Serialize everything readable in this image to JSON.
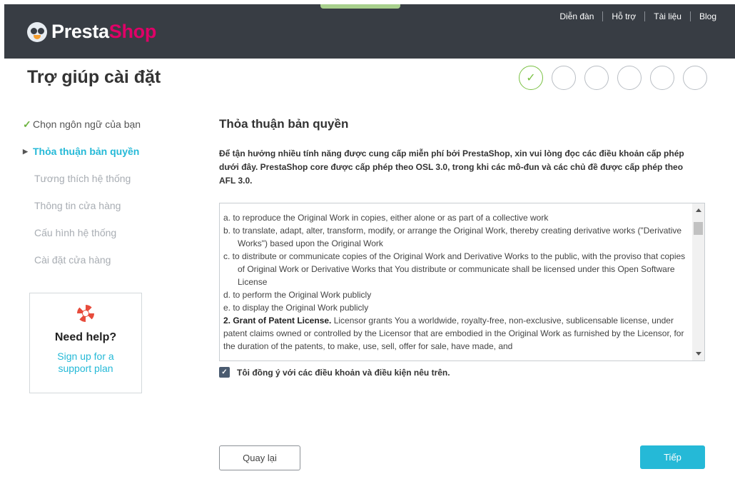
{
  "header": {
    "brand_part1": "Presta",
    "brand_part2": "Shop",
    "links": [
      "Diễn đàn",
      "Hỗ trợ",
      "Tài liệu",
      "Blog"
    ]
  },
  "page_title": "Trợ giúp cài đặt",
  "steps": {
    "total": 6,
    "completed": 1
  },
  "sidebar": {
    "items": [
      {
        "label": "Chọn ngôn ngữ của bạn",
        "state": "done"
      },
      {
        "label": "Thỏa thuận bản quyền",
        "state": "current"
      },
      {
        "label": "Tương thích hệ thống",
        "state": "todo"
      },
      {
        "label": "Thông tin cửa hàng",
        "state": "todo"
      },
      {
        "label": "Cấu hình hệ thống",
        "state": "todo"
      },
      {
        "label": "Cài đặt cửa hàng",
        "state": "todo"
      }
    ],
    "help": {
      "title": "Need help?",
      "link": "Sign up for a support plan"
    }
  },
  "main": {
    "section_title": "Thỏa thuận bản quyền",
    "intro": "Để tận hưởng nhiều tính năng được cung cấp miễn phí bởi PrestaShop, xin vui lòng đọc các điều khoản cấp phép dưới đây. PrestaShop core được cấp phép theo OSL 3.0, trong khi các mô-đun và các chủ đề được cấp phép theo AFL 3.0.",
    "license": {
      "items": [
        "a. to reproduce the Original Work in copies, either alone or as part of a collective work",
        "b. to translate, adapt, alter, transform, modify, or arrange the Original Work, thereby creating derivative works (\"Derivative Works\") based upon the Original Work",
        "c. to distribute or communicate copies of the Original Work and Derivative Works to the public, with the proviso that copies of Original Work or Derivative Works that You distribute or communicate shall be licensed under this Open Software License",
        "d. to perform the Original Work publicly",
        "e. to display the Original Work publicly"
      ],
      "grant_heading": "2. Grant of Patent License.",
      "grant_text": " Licensor grants You a worldwide, royalty-free, non-exclusive, sublicensable license, under patent claims owned or controlled by the Licensor that are embodied in the Original Work as furnished by the Licensor, for the duration of the patents, to make, use, sell, offer for sale, have made, and"
    },
    "agree_label": "Tôi đồng ý với các điều khoản và điều kiện nêu trên.",
    "agree_checked": true,
    "back_label": "Quay lại",
    "next_label": "Tiếp"
  },
  "colors": {
    "accent": "#25b9d7",
    "header_bg": "#383d44",
    "brand_pink": "#df0067",
    "done_green": "#6db33f"
  }
}
